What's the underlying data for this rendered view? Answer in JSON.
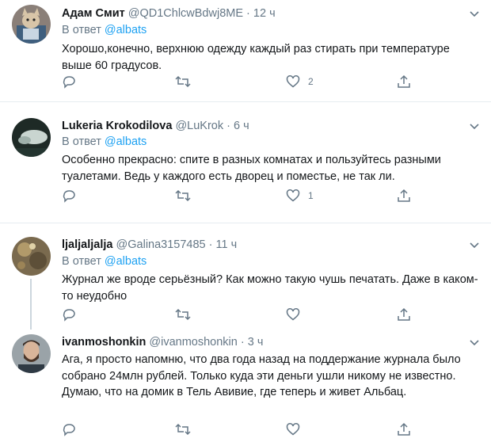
{
  "tweets": [
    {
      "name": "Адам Смит",
      "handle": "@QD1ChlcwBdwj8ME",
      "separator": "·",
      "time": "12 ч",
      "reply_prefix": "В ответ",
      "reply_to": "@albats",
      "text": "Хорошо,конечно, верхнюю одежду каждый раз стирать при температуре выше 60 градусов.",
      "likes": "2",
      "retweets": "",
      "replies": ""
    },
    {
      "name": "Lukeria Krokodilova",
      "handle": "@LuKrok",
      "separator": "·",
      "time": "6 ч",
      "reply_prefix": "В ответ",
      "reply_to": "@albats",
      "text": "Особенно прекрасно: спите в разных комнатах и пользуйтесь разными туалетами. Ведь у каждого есть дворец и поместье, не так ли.",
      "likes": "1",
      "retweets": "",
      "replies": ""
    },
    {
      "name": "ljaljaljalja",
      "handle": "@Galina3157485",
      "separator": "·",
      "time": "11 ч",
      "reply_prefix": "В ответ",
      "reply_to": "@albats",
      "text": "Журнал же вроде серьёзный?  Как можно такую чушь печатать. Даже в каком-то неудобно",
      "likes": "",
      "retweets": "",
      "replies": ""
    },
    {
      "name": "ivanmoshonkin",
      "handle": "@ivanmoshonkin",
      "separator": "·",
      "time": "3 ч",
      "text": "Ага, я просто напомню, что два года назад на поддержание журнала было собрано 24млн рублей. Только куда эти деньги ушли никому не известно. Думаю, что на домик в Тель Авивие, где теперь и живет Альбац.",
      "likes": "",
      "retweets": "",
      "replies": ""
    }
  ],
  "colors": {
    "link": "#1da1f2",
    "secondary": "#657786",
    "divider": "#e6ecf0"
  },
  "icons": [
    "reply-icon",
    "retweet-icon",
    "like-icon",
    "share-icon",
    "chevron-down-icon"
  ]
}
